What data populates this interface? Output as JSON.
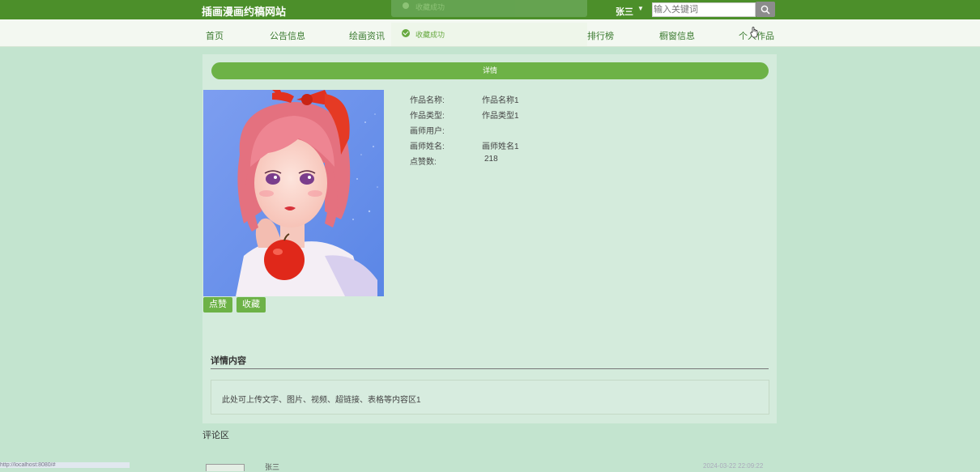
{
  "header": {
    "site_title": "插画漫画约稿网站",
    "toast_ghost_text": "收藏成功",
    "user_name": "张三",
    "user_caret": "▼",
    "search_placeholder": "输入关键词"
  },
  "nav": {
    "items": [
      "首页",
      "公告信息",
      "绘画资讯",
      "排行榜",
      "橱窗信息",
      "个人作品"
    ]
  },
  "toast": {
    "message": "收藏成功"
  },
  "detail": {
    "bar_label": "详情",
    "fields": [
      {
        "label": "作品名称:",
        "value": "作品名称1"
      },
      {
        "label": "作品类型:",
        "value": "作品类型1"
      },
      {
        "label": "画师用户:",
        "value": ""
      },
      {
        "label": "画师姓名:",
        "value": "画师姓名1"
      },
      {
        "label": "点赞数:",
        "value": "218"
      }
    ],
    "like_button": "点赞",
    "favorite_button": "收藏"
  },
  "content": {
    "section_title": "详情内容",
    "body": "此处可上传文字、图片、视频、超链接、表格等内容区1"
  },
  "comments": {
    "title": "评论区",
    "first_user": "张三",
    "first_time": "2024-03-22 22:09:22"
  },
  "status_bar": {
    "url": "http://localhost:8080/#"
  },
  "colors": {
    "topbar": "#4c8f2a",
    "accent": "#6db247",
    "background": "#c3e4cf"
  }
}
